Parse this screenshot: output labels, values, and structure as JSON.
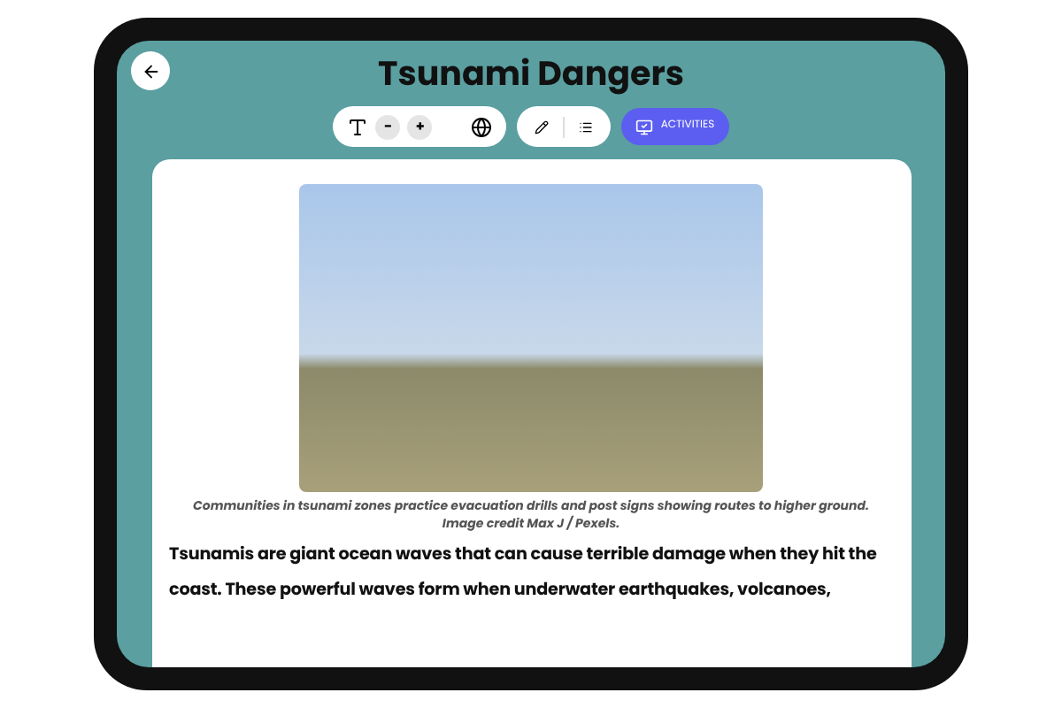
{
  "header": {
    "title": "Tsunami Dangers"
  },
  "toolbar": {
    "decrease_label": "-",
    "increase_label": "+",
    "activities_label": "ACTIVITIES"
  },
  "article": {
    "image_caption": "Communities in tsunami zones practice evacuation drills and post signs showing routes to higher ground. Image credit Max J / Pexels.",
    "paragraph": "Tsunamis are giant ocean waves that can cause terrible damage when they hit the coast. These powerful waves form when underwater earthquakes, volcanoes,"
  }
}
